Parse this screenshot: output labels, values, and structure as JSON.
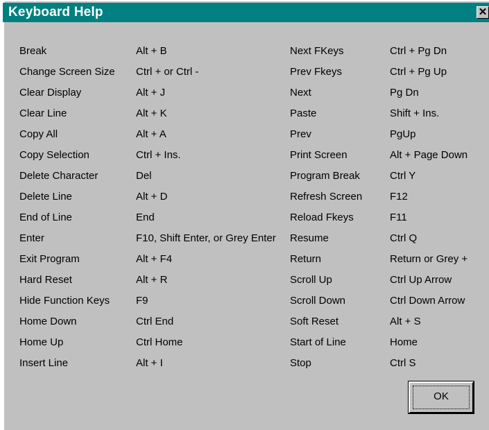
{
  "window": {
    "title": "Keyboard Help",
    "close_glyph": "✕"
  },
  "shortcuts_left": [
    {
      "command": "Break",
      "keys": "Alt + B"
    },
    {
      "command": "Change Screen Size",
      "keys": "Ctrl + or Ctrl -"
    },
    {
      "command": "Clear Display",
      "keys": "Alt + J"
    },
    {
      "command": "Clear Line",
      "keys": "Alt + K"
    },
    {
      "command": "Copy All",
      "keys": "Alt + A"
    },
    {
      "command": "Copy Selection",
      "keys": "Ctrl + Ins."
    },
    {
      "command": "Delete Character",
      "keys": "Del"
    },
    {
      "command": "Delete Line",
      "keys": "Alt + D"
    },
    {
      "command": "End of Line",
      "keys": "End"
    },
    {
      "command": "Enter",
      "keys": "F10, Shift Enter, or Grey Enter"
    },
    {
      "command": "Exit Program",
      "keys": "Alt + F4"
    },
    {
      "command": "Hard Reset",
      "keys": "Alt + R"
    },
    {
      "command": "Hide Function Keys",
      "keys": "F9"
    },
    {
      "command": "Home Down",
      "keys": "Ctrl End"
    },
    {
      "command": "Home Up",
      "keys": "Ctrl Home"
    },
    {
      "command": "Insert Line",
      "keys": "Alt + I"
    }
  ],
  "shortcuts_right": [
    {
      "command": "Next FKeys",
      "keys": "Ctrl + Pg Dn"
    },
    {
      "command": "Prev Fkeys",
      "keys": "Ctrl + Pg Up"
    },
    {
      "command": "Next",
      "keys": "Pg Dn"
    },
    {
      "command": "Paste",
      "keys": "Shift + Ins."
    },
    {
      "command": "Prev",
      "keys": "PgUp"
    },
    {
      "command": "Print Screen",
      "keys": "Alt + Page Down"
    },
    {
      "command": "Program Break",
      "keys": "Ctrl Y"
    },
    {
      "command": "Refresh Screen",
      "keys": "F12"
    },
    {
      "command": "Reload Fkeys",
      "keys": "F11"
    },
    {
      "command": "Resume",
      "keys": "Ctrl Q"
    },
    {
      "command": "Return",
      "keys": "Return or Grey +"
    },
    {
      "command": "Scroll Up",
      "keys": "Ctrl Up Arrow"
    },
    {
      "command": "Scroll Down",
      "keys": "Ctrl Down Arrow"
    },
    {
      "command": "Soft Reset",
      "keys": "Alt + S"
    },
    {
      "command": "Start of Line",
      "keys": "Home"
    },
    {
      "command": "Stop",
      "keys": "Ctrl S"
    }
  ],
  "ok_button": {
    "label": "OK"
  },
  "colors": {
    "titlebar": "#008080",
    "face": "#c0c0c0"
  }
}
